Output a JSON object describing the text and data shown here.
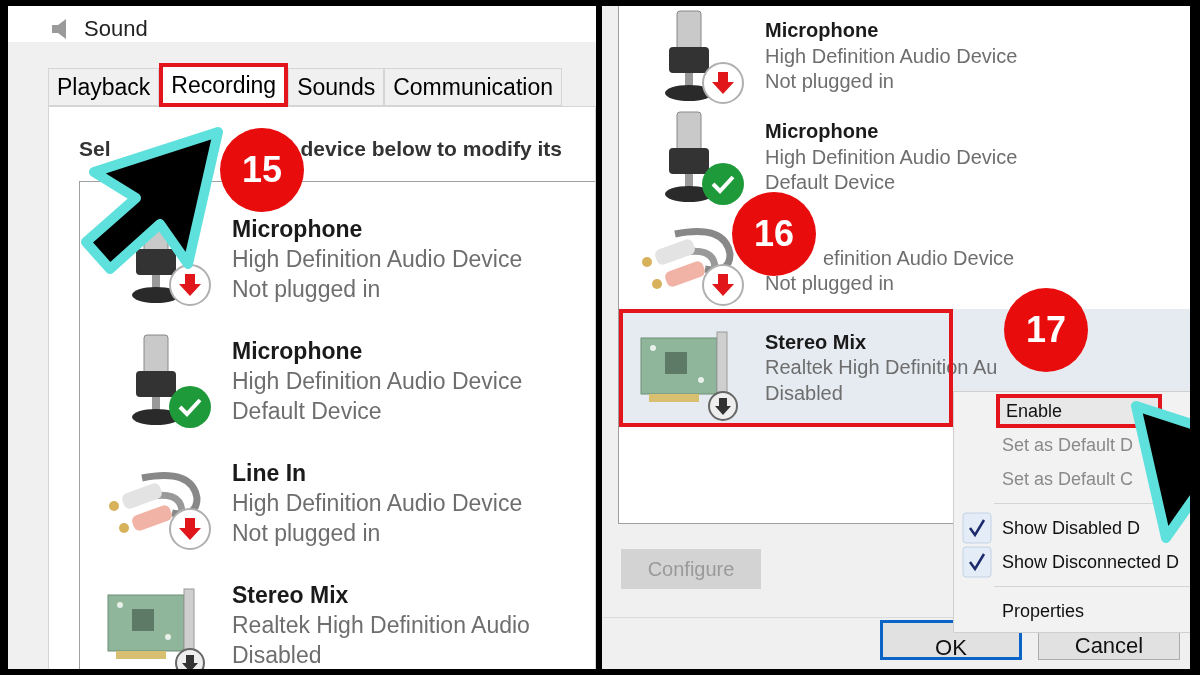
{
  "left": {
    "window": {
      "title": "Sound"
    },
    "tabs": [
      {
        "label": "Playback",
        "selected": false,
        "annotated": false
      },
      {
        "label": "Recording",
        "selected": true,
        "annotated": true
      },
      {
        "label": "Sounds",
        "selected": false,
        "annotated": false
      },
      {
        "label": "Communication",
        "selected": false,
        "annotated": false
      }
    ],
    "instruction_fragments": [
      "Sel",
      "device below to modify its"
    ],
    "devices": [
      {
        "kind": "mic",
        "name": "Microphone",
        "description": "High Definition Audio Device",
        "status": "Not plugged in",
        "plugged_in": false,
        "default": false,
        "disabled": false
      },
      {
        "kind": "mic",
        "name": "Microphone",
        "description": "High Definition Audio Device",
        "status": "Default Device",
        "plugged_in": true,
        "default": true,
        "disabled": false
      },
      {
        "kind": "line",
        "name": "Line In",
        "description": "High Definition Audio Device",
        "status": "Not plugged in",
        "plugged_in": false,
        "default": false,
        "disabled": false
      },
      {
        "kind": "card",
        "name": "Stereo Mix",
        "description": "Realtek High Definition Audio",
        "status": "Disabled",
        "plugged_in": true,
        "default": false,
        "disabled": true
      }
    ],
    "step": "15"
  },
  "right": {
    "devices": [
      {
        "kind": "mic",
        "name": "Microphone",
        "description": "High Definition Audio Device",
        "status": "Not plugged in",
        "plugged_in": false,
        "default": false,
        "disabled": false,
        "selected": false,
        "annotated": false
      },
      {
        "kind": "mic",
        "name": "Microphone",
        "description": "High Definition Audio Device",
        "status": "Default Device",
        "plugged_in": true,
        "default": true,
        "disabled": false,
        "selected": false,
        "annotated": false
      },
      {
        "kind": "line",
        "description": "efinition Audio Device",
        "status": "Not plugged in",
        "plugged_in": false,
        "default": false,
        "disabled": false,
        "selected": false,
        "annotated": false
      },
      {
        "kind": "card",
        "name": "Stereo Mix",
        "description": "Realtek High Definition Au",
        "status": "Disabled",
        "plugged_in": true,
        "default": false,
        "disabled": true,
        "selected": true,
        "annotated": true
      }
    ],
    "buttons": [
      {
        "label": "Configure",
        "disabled": true,
        "default": false
      },
      {
        "label": "OK",
        "disabled": false,
        "default": true
      },
      {
        "label": "Cancel",
        "disabled": false,
        "default": false
      }
    ],
    "context_menu": [
      {
        "kind": "item",
        "label": "Enable",
        "disabled": false,
        "checked": false,
        "annotated": true
      },
      {
        "kind": "item",
        "label": "Set as Default D",
        "disabled": true,
        "checked": false,
        "annotated": false
      },
      {
        "kind": "item",
        "label": "Set as Default C",
        "disabled": true,
        "checked": false,
        "annotated": false
      },
      {
        "kind": "separator"
      },
      {
        "kind": "item",
        "label": "Show Disabled D",
        "disabled": false,
        "checked": true,
        "annotated": false
      },
      {
        "kind": "item",
        "label": "Show Disconnected D",
        "disabled": false,
        "checked": true,
        "annotated": false
      },
      {
        "kind": "separator"
      },
      {
        "kind": "item",
        "label": "Properties",
        "disabled": false,
        "checked": false,
        "annotated": false
      }
    ],
    "steps": [
      "16",
      "17"
    ]
  }
}
